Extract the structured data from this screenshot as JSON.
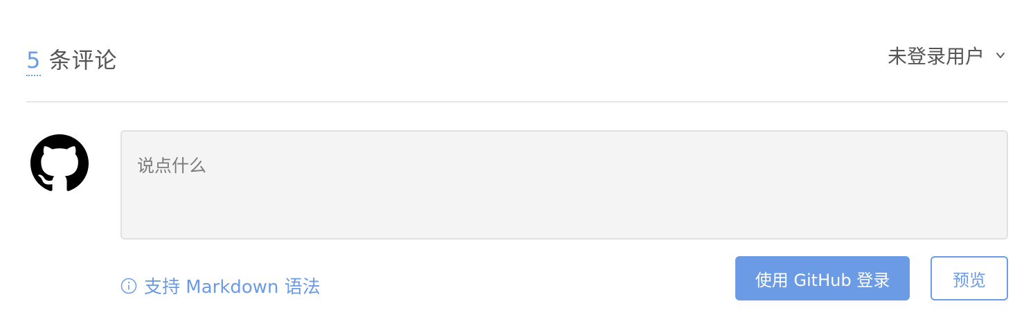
{
  "header": {
    "count": "5",
    "count_label": " 条评论",
    "user_status": "未登录用户"
  },
  "editor": {
    "placeholder": "说点什么",
    "value": ""
  },
  "footer": {
    "markdown_hint": "支持 Markdown 语法",
    "login_label": "使用 GitHub 登录",
    "preview_label": "预览"
  },
  "icons": {
    "avatar": "github-icon",
    "hint": "info-icon",
    "user_menu": "chevron-down-icon"
  },
  "colors": {
    "accent": "#6b9be4",
    "text": "#555555",
    "editor_bg": "#f4f4f4",
    "divider": "#e6e6e6"
  }
}
